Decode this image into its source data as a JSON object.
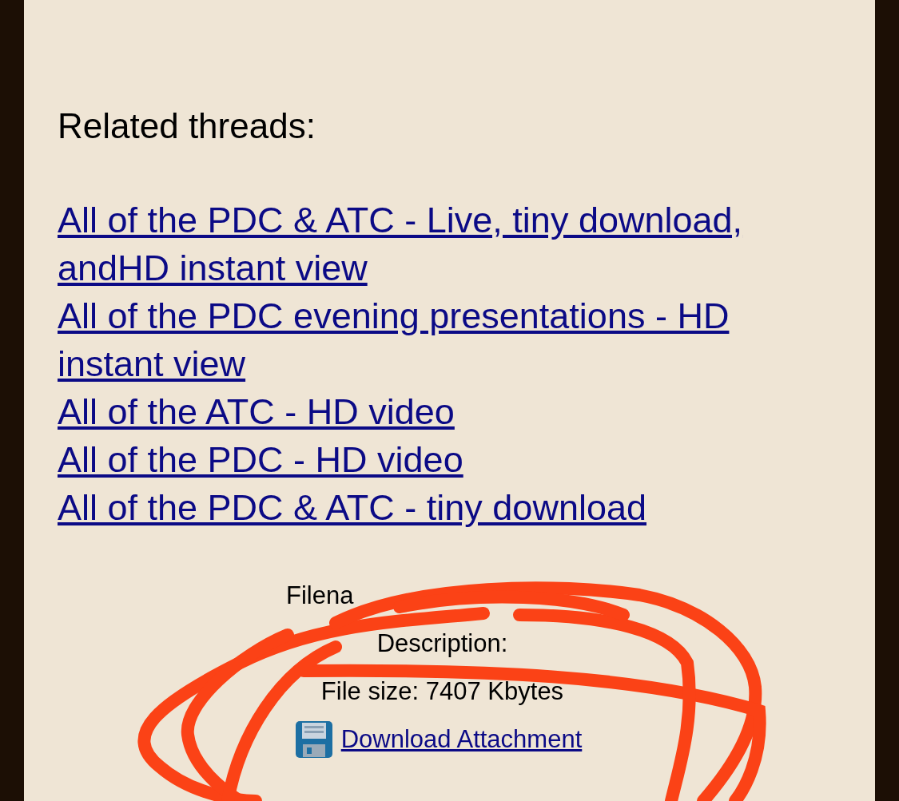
{
  "heading": "Related threads:",
  "threads": [
    "All of the PDC & ATC - Live, tiny download, andHD instant view",
    "All of the PDC evening presentations - HD instant view",
    "All of the ATC - HD video",
    "All of the PDC - HD video",
    "All of the PDC & ATC - tiny download"
  ],
  "attachment": {
    "filename_label": "Filena",
    "description_label": "Description:",
    "file_size": "File size: 7407 Kbytes",
    "download_link": "Download Attachment"
  }
}
